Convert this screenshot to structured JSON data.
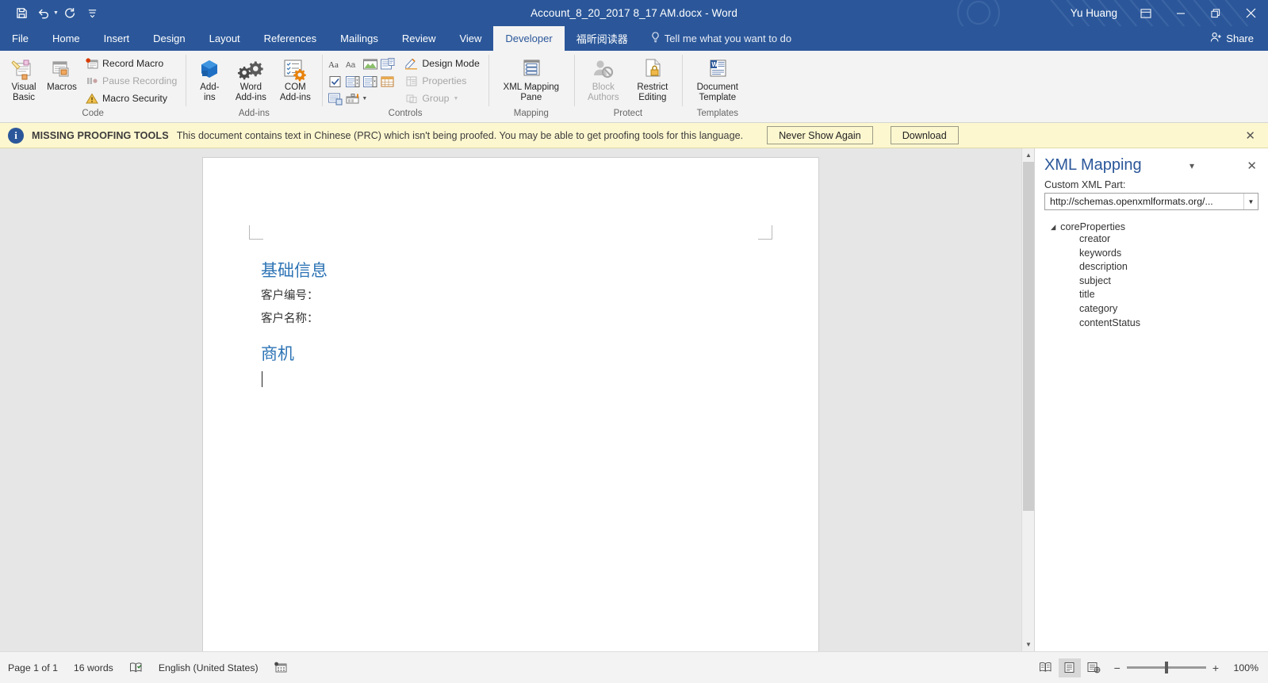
{
  "titlebar": {
    "document_title": "Account_8_20_2017 8_17 AM.docx  -  Word",
    "user_name": "Yu Huang",
    "quick_access": [
      {
        "name": "save-button",
        "icon": "save-icon"
      },
      {
        "name": "undo-button",
        "icon": "undo-icon"
      },
      {
        "name": "redo-button",
        "icon": "redo-icon"
      },
      {
        "name": "customize-quick-access-toolbar-button",
        "icon": "chevron-down-bar-icon"
      }
    ],
    "window_controls": {
      "ribbon_display_options": "⬒",
      "minimize": "—",
      "restore": "❐",
      "close": "✕"
    }
  },
  "tabs": [
    {
      "label": "File",
      "active": false
    },
    {
      "label": "Home",
      "active": false
    },
    {
      "label": "Insert",
      "active": false
    },
    {
      "label": "Design",
      "active": false
    },
    {
      "label": "Layout",
      "active": false
    },
    {
      "label": "References",
      "active": false
    },
    {
      "label": "Mailings",
      "active": false
    },
    {
      "label": "Review",
      "active": false
    },
    {
      "label": "View",
      "active": false
    },
    {
      "label": "Developer",
      "active": true
    },
    {
      "label": "福昕阅读器",
      "active": false
    }
  ],
  "tell_me": "Tell me what you want to do",
  "share_label": "Share",
  "ribbon": {
    "groups": [
      {
        "title": "Code",
        "big_buttons": [
          {
            "label": "Visual\nBasic",
            "line1": "Visual",
            "line2": "Basic",
            "icon": "visual-basic-icon",
            "disabled": false
          },
          {
            "label": "Macros",
            "line1": "Macros",
            "line2": "",
            "icon": "macros-icon",
            "disabled": false
          }
        ],
        "small_buttons": [
          {
            "label": "Record Macro",
            "icon": "record-macro-icon",
            "disabled": false
          },
          {
            "label": "Pause Recording",
            "icon": "pause-recording-icon",
            "disabled": true
          },
          {
            "label": "Macro Security",
            "icon": "macro-security-icon",
            "disabled": false
          }
        ]
      },
      {
        "title": "Add-ins",
        "big_buttons": [
          {
            "line1": "Add-",
            "line2": "ins",
            "icon": "add-ins-icon",
            "disabled": false
          },
          {
            "line1": "Word",
            "line2": "Add-ins",
            "icon": "word-add-ins-icon",
            "disabled": false
          },
          {
            "line1": "COM",
            "line2": "Add-ins",
            "icon": "com-add-ins-icon",
            "disabled": false
          }
        ],
        "small_buttons": []
      },
      {
        "title": "Controls",
        "big_buttons": [],
        "small_buttons": [
          {
            "label": "Design Mode",
            "icon": "design-mode-icon",
            "disabled": false
          },
          {
            "label": "Properties",
            "icon": "properties-icon",
            "disabled": true
          },
          {
            "label": "Group",
            "icon": "group-icon",
            "disabled": true,
            "has_caret": true
          }
        ],
        "control_grid": [
          [
            "rich-text-content-control",
            "plain-text-content-control",
            "picture-content-control",
            "building-block-gallery-content-control"
          ],
          [
            "checkbox-content-control",
            "combo-box-content-control",
            "drop-down-list-content-control",
            "date-picker-content-control"
          ],
          [
            "repeating-section-content-control",
            "legacy-tools-icon"
          ]
        ]
      },
      {
        "title": "Mapping",
        "big_buttons": [
          {
            "line1": "XML Mapping",
            "line2": "Pane",
            "icon": "xml-mapping-pane-icon",
            "disabled": false
          }
        ],
        "small_buttons": []
      },
      {
        "title": "Protect",
        "big_buttons": [
          {
            "line1": "Block",
            "line2": "Authors",
            "icon": "block-authors-icon",
            "disabled": true,
            "has_caret": true
          },
          {
            "line1": "Restrict",
            "line2": "Editing",
            "icon": "restrict-editing-icon",
            "disabled": false
          }
        ],
        "small_buttons": []
      },
      {
        "title": "Templates",
        "big_buttons": [
          {
            "line1": "Document",
            "line2": "Template",
            "icon": "document-template-icon",
            "disabled": false
          }
        ],
        "small_buttons": []
      }
    ]
  },
  "notification": {
    "title": "MISSING PROOFING TOOLS",
    "message": "This document contains text in Chinese (PRC) which isn't being proofed. You may be able to get proofing tools for this language.",
    "never_show_again": "Never Show Again",
    "download": "Download",
    "close": "✕"
  },
  "document": {
    "heading1": "基础信息",
    "line1": "客户编号：",
    "line2": "客户名称：",
    "heading2": "商机"
  },
  "xml_pane": {
    "title": "XML Mapping",
    "menu_icon": "▾",
    "close_icon": "✕",
    "custom_xml_part_label": "Custom XML Part:",
    "selected_part": "http://schemas.openxmlformats.org/...",
    "tree_root": "coreProperties",
    "tree_children": [
      "creator",
      "keywords",
      "description",
      "subject",
      "title",
      "category",
      "contentStatus"
    ]
  },
  "statusbar": {
    "page": "Page 1 of 1",
    "words": "16 words",
    "proofing_icon": "proofing-errors-icon",
    "language": "English (United States)",
    "macro_icon": "record-macro-status-icon",
    "views": [
      {
        "name": "read-mode-view-button",
        "selected": false
      },
      {
        "name": "print-layout-view-button",
        "selected": true
      },
      {
        "name": "web-layout-view-button",
        "selected": false
      }
    ],
    "zoom_out": "−",
    "zoom_in": "+",
    "zoom_value": "100%"
  },
  "colors": {
    "accent": "#2b579a",
    "ribbon_bg": "#f3f3f3",
    "notif_bg": "#fdf7cf",
    "heading_blue": "#2e74b5",
    "workarea_bg": "#e6e6e6"
  }
}
